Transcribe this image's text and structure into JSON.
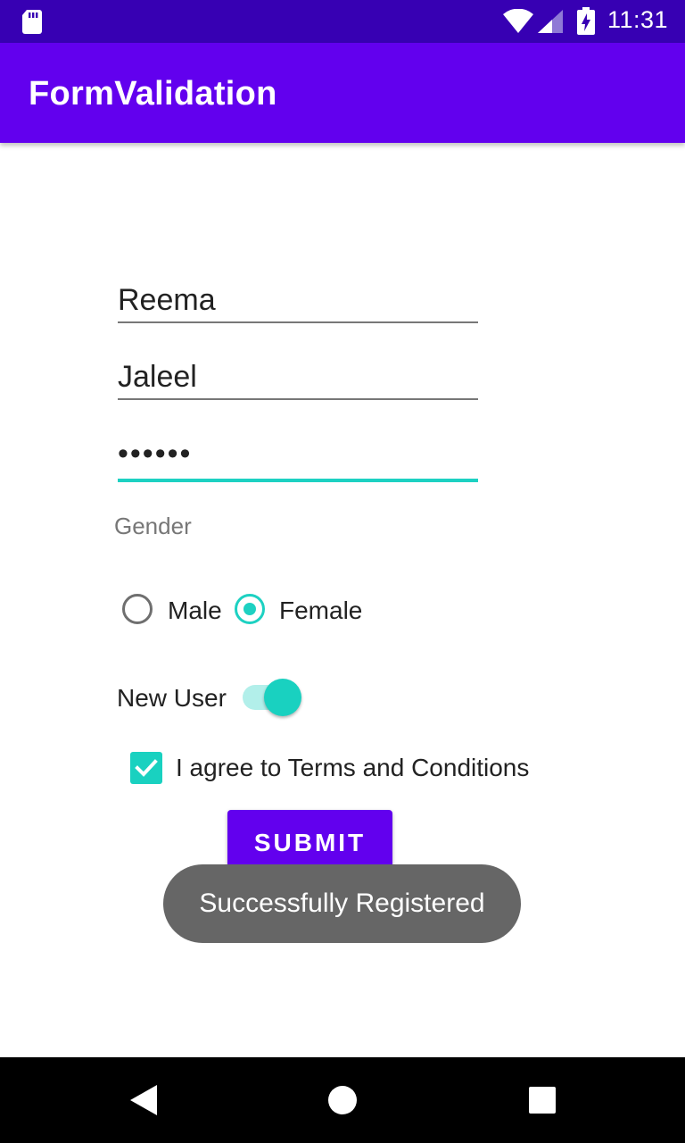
{
  "status_bar": {
    "time": "11:31",
    "icons": [
      "sd-card-icon",
      "wifi-icon",
      "signal-icon",
      "battery-charging-icon"
    ]
  },
  "app_bar": {
    "title": "FormValidation"
  },
  "form": {
    "first_name": "Reema",
    "last_name": "Jaleel",
    "password_masked": "••••••",
    "gender_label": "Gender",
    "gender_options": [
      {
        "label": "Male",
        "selected": false
      },
      {
        "label": "Female",
        "selected": true
      }
    ],
    "new_user_label": "New User",
    "new_user_on": true,
    "terms_label": "I agree to Terms and Conditions",
    "terms_checked": true,
    "submit_label": "SUBMIT"
  },
  "toast": {
    "message": "Successfully Registered"
  },
  "nav_bar": {
    "buttons": [
      "back-icon",
      "home-icon",
      "recents-icon"
    ]
  },
  "colors": {
    "status_bar": "#3700b3",
    "primary": "#6200ee",
    "accent": "#1dd1c2",
    "toast_bg": "#666666"
  }
}
